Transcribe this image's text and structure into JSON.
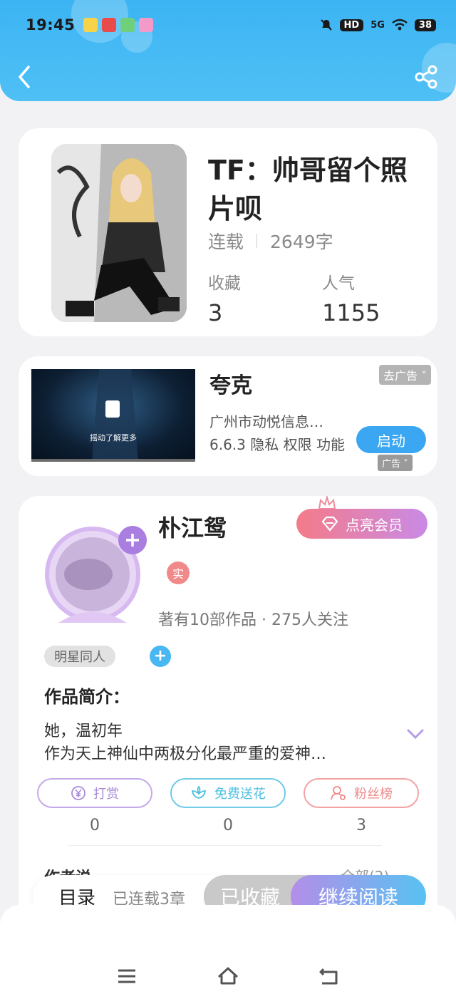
{
  "status_bar": {
    "time": "19:45",
    "network": "5G",
    "hd": "HD",
    "battery": "38"
  },
  "header": {
    "back_icon": "chevron-left-icon",
    "share_icon": "share-icon"
  },
  "book": {
    "title": "TF：帅哥留个照片呗",
    "status": "连载",
    "word_count": "2649字",
    "favorites_label": "收藏",
    "favorites_value": "3",
    "popularity_label": "人气",
    "popularity_value": "1155"
  },
  "ad": {
    "media_text": "摇动了解更多",
    "title": "夸克",
    "company": "广州市动悦信息…",
    "info": "6.6.3 隐私  权限  功能",
    "dismiss_label": "去广告",
    "launch_label": "启动",
    "tag_label": "广告"
  },
  "author": {
    "name": "朴江鸳",
    "vip_label": "点亮会员",
    "real_badge": "实",
    "stats": "著有10部作品 · 275人关注",
    "tag": "明星同人",
    "intro_heading": "作品简介：",
    "intro_line1": "她，温初年",
    "intro_line2": "作为天上神仙中两极分化最严重的爱神…",
    "section_cut": "作者说",
    "section_cut_right": "全部(2)"
  },
  "actions": [
    {
      "label": "打赏",
      "count": "0",
      "color": "#a98bd8",
      "icon": "yen-coin-icon"
    },
    {
      "label": "免费送花",
      "count": "0",
      "color": "#4bbfe0",
      "icon": "flower-icon"
    },
    {
      "label": "粉丝榜",
      "count": "3",
      "color": "#ee8a8a",
      "icon": "fan-user-icon"
    }
  ],
  "read_bar": {
    "toc_label": "目录",
    "serial_label": "已连载3章",
    "collected_label": "已收藏",
    "continue_label": "继续阅读"
  },
  "colors": {
    "header_blue": "#3cb4f3",
    "accent_pink": "#f47b89",
    "accent_purple": "#c98ae6"
  }
}
